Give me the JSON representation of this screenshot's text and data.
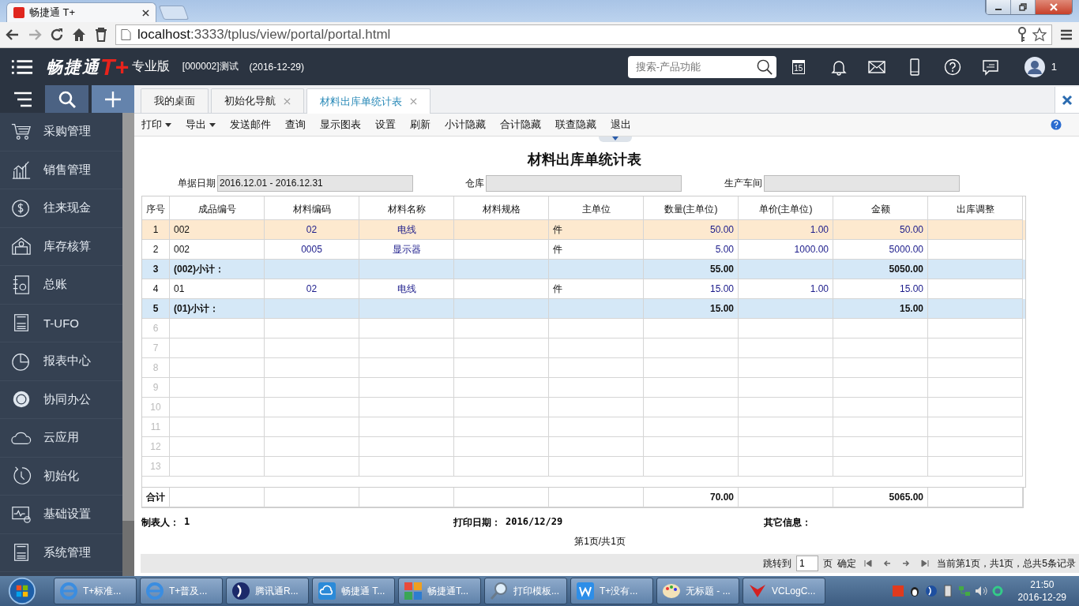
{
  "browser": {
    "tab_title": "畅捷通 T+",
    "address_host": "localhost",
    "address_path": ":3333/tplus/view/portal/portal.html"
  },
  "header": {
    "logo_name": "畅捷通",
    "logo_mark": "T+",
    "edition": "专业版",
    "account": "[000002]测试",
    "date": "(2016-12-29)",
    "search_placeholder": "搜索-产品功能",
    "calendar_day": "15",
    "user_count": "1"
  },
  "sidebar": {
    "items": [
      {
        "label": "采购管理"
      },
      {
        "label": "销售管理"
      },
      {
        "label": "往来现金"
      },
      {
        "label": "库存核算"
      },
      {
        "label": "总账"
      },
      {
        "label": "T-UFO"
      },
      {
        "label": "报表中心"
      },
      {
        "label": "协同办公"
      },
      {
        "label": "云应用"
      },
      {
        "label": "初始化"
      },
      {
        "label": "基础设置"
      },
      {
        "label": "系统管理"
      }
    ]
  },
  "tabs": [
    {
      "label": "我的桌面",
      "selected": false,
      "closable": false
    },
    {
      "label": "初始化导航",
      "selected": false,
      "closable": true
    },
    {
      "label": "材料出库单统计表",
      "selected": true,
      "closable": true
    }
  ],
  "toolbar": [
    {
      "label": "打印",
      "dropdown": true
    },
    {
      "label": "导出",
      "dropdown": true
    },
    {
      "label": "发送邮件",
      "dropdown": false
    },
    {
      "label": "查询",
      "dropdown": false
    },
    {
      "label": "显示图表",
      "dropdown": false
    },
    {
      "label": "设置",
      "dropdown": false
    },
    {
      "label": "刷新",
      "dropdown": false
    },
    {
      "label": "小计隐藏",
      "dropdown": false
    },
    {
      "label": "合计隐藏",
      "dropdown": false
    },
    {
      "label": "联查隐藏",
      "dropdown": false
    },
    {
      "label": "退出",
      "dropdown": false
    }
  ],
  "report": {
    "title": "材料出库单统计表",
    "filters": [
      {
        "label": "单据日期",
        "value": "2016.12.01 - 2016.12.31"
      },
      {
        "label": "仓库"
      },
      {
        "label": "生产车间"
      }
    ],
    "columns": [
      {
        "label": "序号",
        "kind": "index"
      },
      {
        "label": "成品编号",
        "kind": "text"
      },
      {
        "label": "材料编码",
        "kind": "link"
      },
      {
        "label": "材料名称",
        "kind": "link"
      },
      {
        "label": "材料规格",
        "kind": "text"
      },
      {
        "label": "主单位",
        "kind": "text"
      },
      {
        "label": "数量(主单位)",
        "kind": "number"
      },
      {
        "label": "单价(主单位)",
        "kind": "number"
      },
      {
        "label": "金额",
        "kind": "number"
      },
      {
        "label": "出库调整",
        "kind": "text"
      }
    ],
    "rows": [
      {
        "kind": "detail",
        "selected": true,
        "no": "1",
        "product": "002",
        "code": "02",
        "name": "电线",
        "unit": "件",
        "qty": "50.00",
        "price": "1.00",
        "amount": "50.00"
      },
      {
        "kind": "detail",
        "selected": false,
        "no": "2",
        "product": "002",
        "code": "0005",
        "name": "显示器",
        "unit": "件",
        "qty": "5.00",
        "price": "1000.00",
        "amount": "5000.00"
      },
      {
        "kind": "subtotal",
        "selected": false,
        "no": "3",
        "product": "(002)小计：",
        "qty": "55.00",
        "amount": "5050.00"
      },
      {
        "kind": "detail",
        "selected": false,
        "no": "4",
        "product": "01",
        "code": "02",
        "name": "电线",
        "unit": "件",
        "qty": "15.00",
        "price": "1.00",
        "amount": "15.00"
      },
      {
        "kind": "subtotal",
        "selected": false,
        "no": "5",
        "product": "(01)小计：",
        "qty": "15.00",
        "amount": "15.00"
      },
      {
        "kind": "empty",
        "selected": false,
        "no": "6"
      },
      {
        "kind": "empty",
        "selected": false,
        "no": "7"
      },
      {
        "kind": "empty",
        "selected": false,
        "no": "8"
      },
      {
        "kind": "empty",
        "selected": false,
        "no": "9"
      },
      {
        "kind": "empty",
        "selected": false,
        "no": "10"
      },
      {
        "kind": "empty",
        "selected": false,
        "no": "11"
      },
      {
        "kind": "empty",
        "selected": false,
        "no": "12"
      },
      {
        "kind": "empty",
        "selected": false,
        "no": "13"
      }
    ],
    "total": {
      "label": "合计",
      "qty": "70.00",
      "amount": "5065.00"
    },
    "footer": [
      {
        "label": "制表人：",
        "value": "1"
      },
      {
        "label": "打印日期：",
        "value": "2016/12/29"
      },
      {
        "label": "其它信息："
      }
    ],
    "page_info": "第1页/共1页"
  },
  "pager": {
    "jump_label": "跳转到",
    "page_value": "1",
    "page_unit": "页",
    "confirm": "确定",
    "status": "当前第1页，共1页，总共5条记录"
  },
  "taskbar": {
    "items": [
      {
        "label": "T+标准..."
      },
      {
        "label": "T+普及..."
      },
      {
        "label": "腾讯通R..."
      },
      {
        "label": "畅捷通 T..."
      },
      {
        "label": "畅捷通T..."
      },
      {
        "label": "打印模板..."
      },
      {
        "label": "T+没有..."
      },
      {
        "label": "无标题 - ..."
      },
      {
        "label": "VCLogC..."
      }
    ],
    "time": "21:50",
    "date": "2016-12-29"
  }
}
